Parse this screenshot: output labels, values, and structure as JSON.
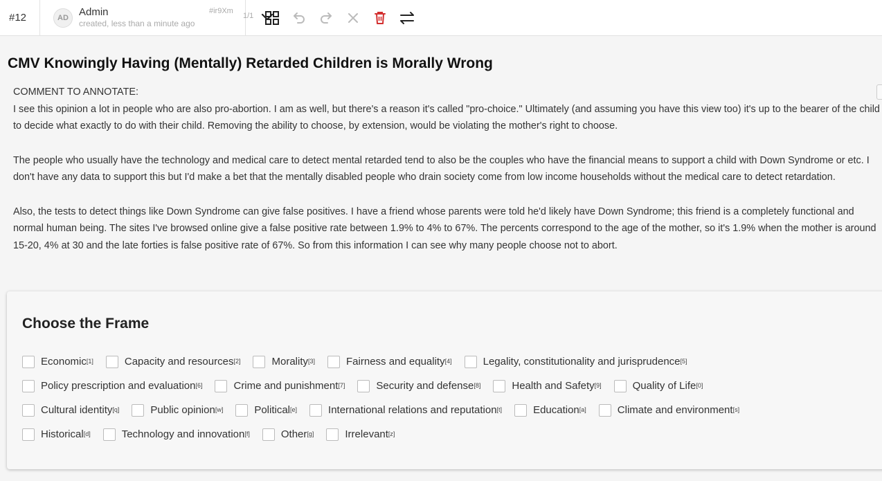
{
  "topbar": {
    "task_id": "#12",
    "avatar_initials": "AD",
    "user": "Admin",
    "created": "created, less than a minute ago",
    "hash": "#ir9Xm",
    "count": "1/1",
    "icons": [
      "grid-icon",
      "undo-icon",
      "redo-icon",
      "reset-icon",
      "delete-icon",
      "settings-icon"
    ],
    "delete_color": "#d32f2f"
  },
  "title": "CMV Knowingly Having (Mentally) Retarded Children is Morally Wrong",
  "comment": {
    "label": "COMMENT TO ANNOTATE:",
    "paragraphs": [
      "I see this opinion a lot in people who are also pro-abortion. I am as well, but there's a reason it's called \"pro-choice.\" Ultimately (and assuming you have this view too) it's up to the bearer of the child to decide what exactly to do with their child. Removing the ability to choose, by extension, would be violating the mother's right to choose.",
      "The people who usually have the technology and medical care to detect mental retarded tend to also be the couples who have the financial means to support a child with Down Syndrome or etc. I don't have any data to support this but I'd make a bet that the mentally disabled people who drain society come from low income households without the medical care to detect retardation.",
      "Also, the tests to detect things like Down Syndrome can give false positives. I have a friend whose parents were told he'd likely have Down Syndrome; this friend is a completely functional and normal human being. The sites I've browsed online give a false positive rate between 1.9% to 4% to 67%. The percents correspond to the age of the mother, so it's 1.9% when the mother is around 15-20, 4% at 30 and the late forties is false positive rate of 67%. So from this information I can see why many people choose not to abort."
    ]
  },
  "frame": {
    "title": "Choose the Frame",
    "rows": [
      [
        {
          "label": "Economic",
          "key": "[1]"
        },
        {
          "label": "Capacity and resources",
          "key": "[2]"
        },
        {
          "label": "Morality",
          "key": "[3]"
        },
        {
          "label": "Fairness and equality",
          "key": "[4]"
        },
        {
          "label": "Legality, constitutionality and jurisprudence",
          "key": "[5]"
        }
      ],
      [
        {
          "label": "Policy prescription and evaluation",
          "key": "[6]"
        },
        {
          "label": "Crime and punishment",
          "key": "[7]"
        },
        {
          "label": "Security and defense",
          "key": "[8]"
        },
        {
          "label": "Health and Safety",
          "key": "[9]"
        },
        {
          "label": "Quality of Life",
          "key": "[0]"
        }
      ],
      [
        {
          "label": "Cultural identity",
          "key": "[q]"
        },
        {
          "label": "Public opinion",
          "key": "[w]"
        },
        {
          "label": "Political",
          "key": "[e]"
        },
        {
          "label": "International relations and reputation",
          "key": "[t]"
        },
        {
          "label": "Education",
          "key": "[a]"
        },
        {
          "label": "Climate and environment",
          "key": "[s]"
        }
      ],
      [
        {
          "label": "Historical",
          "key": "[d]"
        },
        {
          "label": "Technology and innovation",
          "key": "[f]"
        },
        {
          "label": "Other",
          "key": "[g]"
        },
        {
          "label": "Irrelevant",
          "key": "[z]"
        }
      ]
    ]
  }
}
